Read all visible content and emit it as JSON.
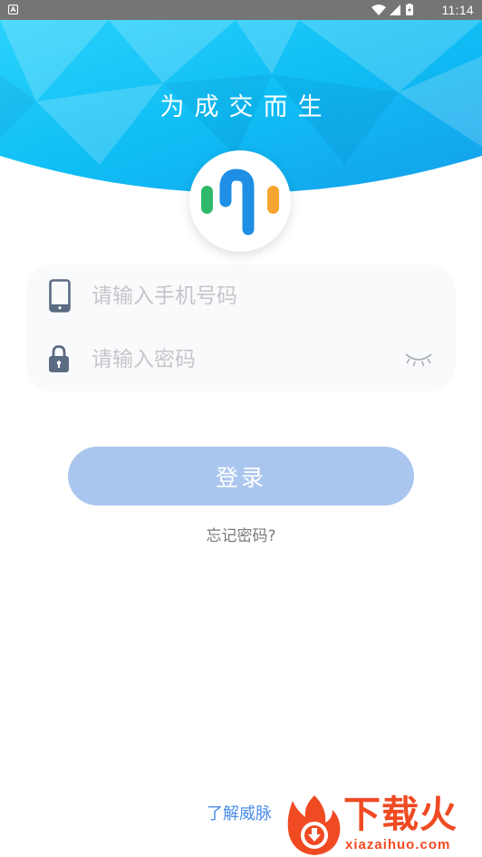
{
  "status_bar": {
    "time": "11:14",
    "notification_icon": "android-notification-icon",
    "icons": [
      "wifi-icon",
      "cellular-signal-icon",
      "battery-charging-icon"
    ],
    "background": "#757575"
  },
  "header": {
    "slogan": "为成交而生",
    "gradient_colors": [
      "#0ec3f6",
      "#14a8ec"
    ]
  },
  "logo": {
    "icon": "audio-bars-logo-icon",
    "bar_colors": [
      "#2fba6b",
      "#1e8fe5",
      "#f7a531"
    ]
  },
  "form": {
    "phone": {
      "placeholder": "请输入手机号码",
      "value": "",
      "icon": "phone-icon"
    },
    "password": {
      "placeholder": "请输入密码",
      "value": "",
      "icon": "lock-icon",
      "toggle_icon": "eye-closed-icon"
    }
  },
  "actions": {
    "login_label": "登录",
    "forgot_label": "忘记密码?",
    "about_label": "了解威脉"
  },
  "watermark": {
    "title": "下载火",
    "url": "xiazaihuo.com",
    "icon": "flame-download-icon"
  },
  "colors": {
    "login_button": "#abc6ee",
    "link": "#4a8ee8",
    "watermark": "#f04a23"
  }
}
